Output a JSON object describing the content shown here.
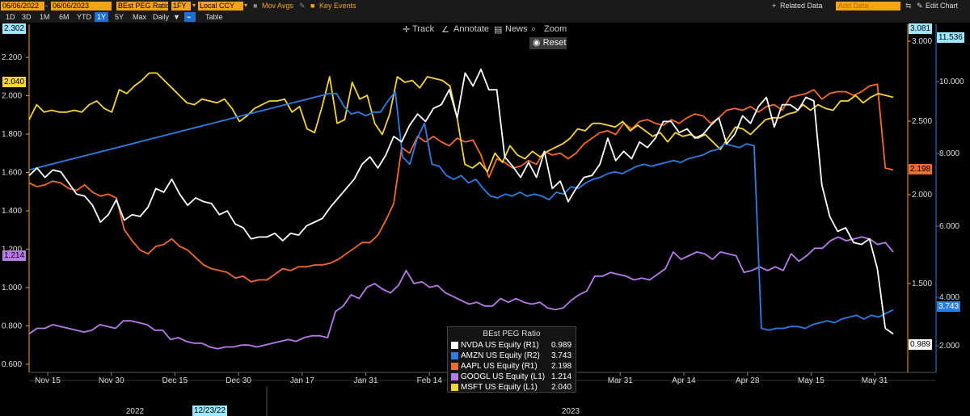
{
  "toolbar": {
    "start_date": "06/06/2022",
    "end_date": "06/06/2023",
    "field": "BEst PEG Ratio",
    "period": "1FY",
    "currency": "Local CCY",
    "mov_avgs": "Mov Avgs",
    "key_events": "Key Events",
    "related_data": "Related Data",
    "add_data_placeholder": "Add Data",
    "edit_chart": "Edit Chart",
    "ranges": [
      "1D",
      "3D",
      "1M",
      "6M",
      "YTD",
      "1Y",
      "5Y",
      "Max"
    ],
    "selected_range": "1Y",
    "frequency": "Daily",
    "table": "Table"
  },
  "chart_tools": {
    "track": "Track",
    "annotate": "Annotate",
    "news": "News",
    "zoom": "Zoom",
    "reset": "Reset"
  },
  "colors": {
    "NVDA": "#ffffff",
    "AMZN": "#2f7de1",
    "AAPL": "#f26a2c",
    "GOOGL": "#b77ae8",
    "MSFT": "#f5d33a",
    "axis": "#f4a21f"
  },
  "chart_data": {
    "type": "line",
    "x_ticks": [
      "Nov 15",
      "Nov 30",
      "Dec 15",
      "Dec 30",
      "Jan 17",
      "Jan 31",
      "Feb 14",
      "Feb 28",
      "Mar 15",
      "Mar 31",
      "Apr 14",
      "Apr 28",
      "May 15",
      "May 31"
    ],
    "years": [
      "2022",
      "2023"
    ],
    "crosshair_date": "12/23/22",
    "left_axis": {
      "ticks": [
        "0.600",
        "0.800",
        "1.000",
        "1.200",
        "1.400",
        "1.600",
        "1.800",
        "2.000",
        "2.200"
      ],
      "ylim": [
        0.57,
        2.31
      ],
      "top_label": "2.302"
    },
    "right1_axis": {
      "ticks": [
        "2.000",
        "1.500",
        "2.000",
        "2.500",
        "3.000"
      ],
      "top_label": "3.081",
      "ylim": [
        0.85,
        3.08
      ]
    },
    "right2_axis": {
      "ticks": [
        "2.000",
        "4.000",
        "6.000",
        "8.000",
        "10.000"
      ],
      "top_label": "11.536",
      "ylim": [
        0.0,
        11.54
      ]
    },
    "legend_title": "BEst PEG Ratio",
    "series": [
      {
        "name": "NVDA US Equity",
        "axis": "(R1)",
        "last": "0.989",
        "values": [
          1.62,
          1.66,
          1.61,
          1.65,
          1.64,
          1.58,
          1.52,
          1.51,
          1.46,
          1.37,
          1.41,
          1.49,
          1.38,
          1.41,
          1.4,
          1.45,
          1.55,
          1.53,
          1.6,
          1.52,
          1.46,
          1.5,
          1.48,
          1.47,
          1.41,
          1.43,
          1.36,
          1.34,
          1.28,
          1.29,
          1.29,
          1.31,
          1.27,
          1.31,
          1.3,
          1.35,
          1.37,
          1.39,
          1.45,
          1.5,
          1.55,
          1.6,
          1.68,
          1.72,
          1.66,
          1.73,
          1.83,
          1.8,
          1.89,
          1.95,
          1.91,
          1.98,
          2.0,
          2.08,
          1.93,
          2.17,
          2.1,
          2.19,
          2.08,
          2.08,
          1.72,
          1.67,
          1.61,
          1.69,
          1.61,
          1.75,
          1.55,
          1.59,
          1.48,
          1.55,
          1.61,
          1.62,
          1.68,
          1.82,
          1.7,
          1.75,
          1.71,
          1.8,
          1.77,
          1.82,
          1.91,
          1.91,
          1.85,
          1.87,
          1.82,
          1.84,
          1.89,
          1.93,
          1.79,
          1.84,
          1.94,
          1.9,
          1.99,
          2.04,
          1.88,
          2.0,
          2.0,
          1.97,
          2.04,
          2.02,
          1.57,
          1.4,
          1.32,
          1.34,
          1.26,
          1.25,
          1.28,
          1.12,
          0.8,
          0.77
        ]
      },
      {
        "name": "AMZN US Equity",
        "axis": "(R2)",
        "last": "3.743",
        "values": [
          1.65,
          1.66,
          1.67,
          1.68,
          1.69,
          1.7,
          1.71,
          1.72,
          1.73,
          1.74,
          1.75,
          1.76,
          1.77,
          1.78,
          1.79,
          1.8,
          1.81,
          1.82,
          1.83,
          1.84,
          1.85,
          1.86,
          1.87,
          1.88,
          1.89,
          1.9,
          1.91,
          1.92,
          1.93,
          1.94,
          1.95,
          1.96,
          1.97,
          1.98,
          1.99,
          2.0,
          2.01,
          2.02,
          2.03,
          2.04,
          2.05,
          2.06,
          2.06,
          1.99,
          1.95,
          1.96,
          1.94,
          1.96,
          1.96,
          2.02,
          2.07,
          1.72,
          1.68,
          1.82,
          1.9,
          1.68,
          1.67,
          1.62,
          1.6,
          1.62,
          1.58,
          1.6,
          1.55,
          1.51,
          1.5,
          1.52,
          1.51,
          1.53,
          1.51,
          1.52,
          1.51,
          1.49,
          1.53,
          1.52,
          1.56,
          1.55,
          1.58,
          1.6,
          1.61,
          1.63,
          1.64,
          1.63,
          1.65,
          1.67,
          1.68,
          1.67,
          1.68,
          1.69,
          1.7,
          1.69,
          1.71,
          1.72,
          1.73,
          1.75,
          1.76,
          1.79,
          1.78,
          1.77,
          1.79,
          1.78,
          0.8,
          0.79,
          0.8,
          0.8,
          0.81,
          0.81,
          0.8,
          0.82,
          0.83,
          0.84,
          0.83,
          0.85,
          0.86,
          0.87,
          0.85,
          0.87,
          0.86,
          0.88,
          0.9
        ]
      },
      {
        "name": "AAPL US Equity",
        "axis": "(R1)",
        "last": "2.198",
        "values": [
          1.58,
          1.56,
          1.57,
          1.59,
          1.58,
          1.55,
          1.54,
          1.57,
          1.53,
          1.51,
          1.52,
          1.5,
          1.33,
          1.27,
          1.22,
          1.2,
          1.24,
          1.25,
          1.28,
          1.24,
          1.22,
          1.18,
          1.14,
          1.12,
          1.11,
          1.1,
          1.07,
          1.08,
          1.05,
          1.06,
          1.06,
          1.09,
          1.12,
          1.11,
          1.13,
          1.13,
          1.14,
          1.14,
          1.15,
          1.17,
          1.2,
          1.23,
          1.26,
          1.26,
          1.3,
          1.38,
          1.47,
          1.77,
          1.74,
          1.83,
          1.8,
          1.83,
          1.8,
          1.78,
          1.82,
          1.8,
          1.81,
          1.73,
          1.61,
          1.71,
          1.69,
          1.66,
          1.67,
          1.7,
          1.68,
          1.75,
          1.73,
          1.74,
          1.71,
          1.74,
          1.79,
          1.82,
          1.85,
          1.86,
          1.84,
          1.9,
          1.87,
          1.91,
          1.92,
          1.9,
          1.89,
          1.92,
          1.9,
          1.93,
          1.95,
          1.94,
          1.9,
          1.93,
          1.97,
          1.98,
          1.97,
          1.99,
          1.96,
          1.99,
          2.0,
          1.97,
          2.04,
          2.05,
          2.06,
          2.08,
          2.03,
          2.06,
          2.07,
          2.07,
          2.05,
          2.07,
          2.1,
          2.11,
          1.66,
          1.65
        ]
      },
      {
        "name": "GOOGL US Equity",
        "axis": "(L1)",
        "last": "1.214",
        "values": [
          0.77,
          0.8,
          0.8,
          0.82,
          0.81,
          0.8,
          0.79,
          0.78,
          0.79,
          0.82,
          0.81,
          0.8,
          0.84,
          0.84,
          0.83,
          0.82,
          0.79,
          0.79,
          0.74,
          0.75,
          0.73,
          0.72,
          0.72,
          0.7,
          0.69,
          0.7,
          0.7,
          0.71,
          0.71,
          0.7,
          0.71,
          0.72,
          0.73,
          0.74,
          0.73,
          0.75,
          0.76,
          0.76,
          0.75,
          0.89,
          0.92,
          0.98,
          0.96,
          1.02,
          1.04,
          1.01,
          0.99,
          1.03,
          1.11,
          1.04,
          1.05,
          1.02,
          1.03,
          0.99,
          0.97,
          0.95,
          0.93,
          0.94,
          0.92,
          0.92,
          0.96,
          0.94,
          0.96,
          0.94,
          0.93,
          0.94,
          0.91,
          0.9,
          0.91,
          0.95,
          0.98,
          1.0,
          1.08,
          1.08,
          1.1,
          1.09,
          1.08,
          1.06,
          1.07,
          1.06,
          1.09,
          1.12,
          1.21,
          1.17,
          1.19,
          1.21,
          1.2,
          1.17,
          1.21,
          1.2,
          1.19,
          1.1,
          1.11,
          1.13,
          1.11,
          1.13,
          1.11,
          1.2,
          1.16,
          1.19,
          1.23,
          1.23,
          1.27,
          1.29,
          1.27,
          1.28,
          1.29,
          1.28,
          1.25,
          1.26,
          1.21
        ]
      },
      {
        "name": "MSFT US Equity",
        "axis": "(L1)",
        "last": "2.040",
        "values": [
          1.92,
          2.0,
          1.96,
          1.97,
          1.96,
          1.96,
          1.97,
          1.96,
          2.0,
          2.02,
          1.98,
          1.96,
          2.08,
          2.06,
          2.1,
          2.13,
          2.17,
          2.17,
          2.13,
          2.09,
          2.05,
          2.01,
          2.0,
          2.03,
          2.02,
          2.01,
          2.03,
          1.98,
          1.91,
          1.94,
          1.98,
          2.0,
          2.02,
          2.02,
          2.03,
          1.96,
          1.99,
          1.87,
          1.85,
          1.99,
          2.15,
          1.9,
          1.92,
          2.12,
          2.03,
          2.05,
          1.9,
          1.84,
          1.95,
          2.15,
          2.12,
          2.13,
          2.09,
          2.15,
          2.14,
          2.13,
          2.1,
          1.92,
          1.68,
          1.66,
          1.69,
          1.64,
          1.74,
          1.69,
          1.78,
          1.73,
          1.71,
          1.75,
          1.72,
          1.75,
          1.77,
          1.79,
          1.82,
          1.87,
          1.86,
          1.9,
          1.9,
          1.89,
          1.88,
          1.91,
          1.86,
          1.89,
          1.86,
          1.83,
          1.85,
          1.8,
          1.85,
          1.83,
          1.84,
          1.82,
          1.84,
          1.8,
          1.76,
          1.82,
          1.88,
          1.87,
          1.84,
          1.88,
          1.92,
          1.93,
          1.93,
          1.95,
          1.96,
          2.0,
          1.97,
          2.0,
          1.98,
          1.97,
          2.02,
          2.02,
          2.05,
          2.01,
          2.04,
          2.06,
          2.05,
          2.04
        ]
      }
    ]
  }
}
